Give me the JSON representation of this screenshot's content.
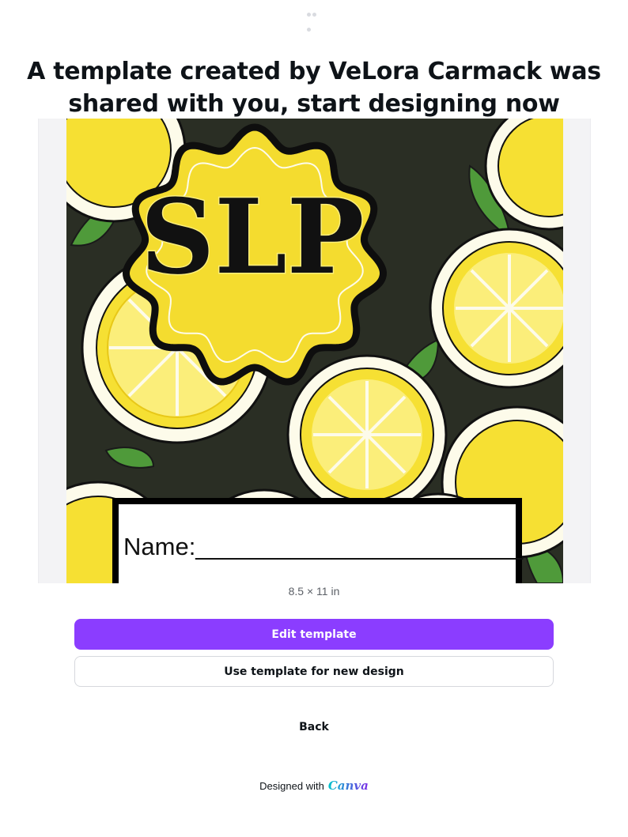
{
  "header": {
    "title": "A template created by VeLora Carmack was shared with you, start designing now"
  },
  "preview": {
    "badge_text": "SLP",
    "name_line": "Name:________________________",
    "size_label": "8.5 × 11 in",
    "colors": {
      "lemon": "#f6e033",
      "lemon_light": "#fbee7a",
      "background": "#2a2e24",
      "leaf": "#4f9a3a",
      "badge": "#f4dc2f"
    }
  },
  "actions": {
    "edit_label": "Edit template",
    "use_label": "Use template for new design",
    "back_label": "Back"
  },
  "footer": {
    "designed_with": "Designed with",
    "brand": "Canva"
  },
  "colors": {
    "primary": "#8b3dff",
    "text": "#0e1318"
  }
}
